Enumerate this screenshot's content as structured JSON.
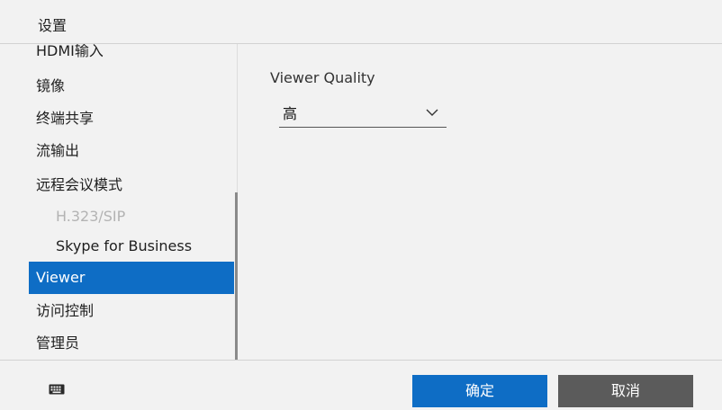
{
  "window": {
    "title": "设置"
  },
  "sidebar": {
    "items": [
      {
        "label": "HDMI输入",
        "state": "normal"
      },
      {
        "label": "镜像",
        "state": "normal"
      },
      {
        "label": "终端共享",
        "state": "normal"
      },
      {
        "label": "流输出",
        "state": "normal"
      },
      {
        "label": "远程会议模式",
        "state": "normal"
      },
      {
        "label": "H.323/SIP",
        "state": "disabled"
      },
      {
        "label": "Skype for Business",
        "state": "normal"
      },
      {
        "label": "Viewer",
        "state": "selected"
      },
      {
        "label": "访问控制",
        "state": "normal"
      },
      {
        "label": "管理员",
        "state": "normal"
      }
    ]
  },
  "content": {
    "viewer_quality": {
      "label": "Viewer Quality",
      "selected_value": "高"
    }
  },
  "footer": {
    "ok_label": "确定",
    "cancel_label": "取消"
  },
  "colors": {
    "accent": "#0e6dc5",
    "cancel_button": "#5b5b5b",
    "background": "#f2f2f2"
  },
  "icons": {
    "keyboard": "keyboard-icon",
    "dropdown": "chevron-down-icon"
  }
}
